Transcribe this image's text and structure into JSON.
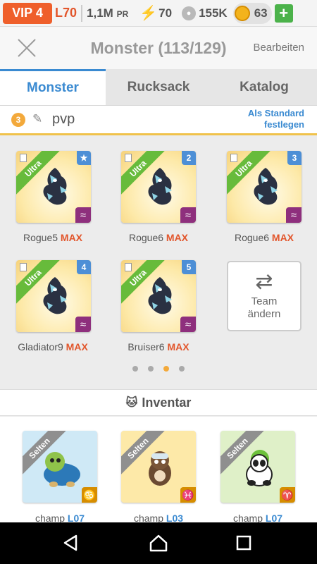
{
  "status": {
    "vip": "VIP 4",
    "level": "L70",
    "pr_value": "1,1M",
    "pr_suffix": "PR",
    "energy": "70",
    "paws": "155K",
    "gems": "63",
    "add_label": "+"
  },
  "header": {
    "title": "Monster (113/129)",
    "edit": "Bearbeiten"
  },
  "tabs": [
    {
      "label": "Monster",
      "active": true
    },
    {
      "label": "Rucksack",
      "active": false
    },
    {
      "label": "Katalog",
      "active": false
    }
  ],
  "team": {
    "number": "3",
    "name": "pvp",
    "default_line1": "Als Standard",
    "default_line2": "festlegen"
  },
  "monsters": [
    {
      "rarity": "Ultra",
      "slot": "★",
      "name": "Rogue5",
      "max": "MAX",
      "element": "≈"
    },
    {
      "rarity": "Ultra",
      "slot": "2",
      "name": "Rogue6",
      "max": "MAX",
      "element": "≈"
    },
    {
      "rarity": "Ultra",
      "slot": "3",
      "name": "Rogue6",
      "max": "MAX",
      "element": "≈"
    },
    {
      "rarity": "Ultra",
      "slot": "4",
      "name": "Gladiator9",
      "max": "MAX",
      "element": "≈"
    },
    {
      "rarity": "Ultra",
      "slot": "5",
      "name": "Bruiser6",
      "max": "MAX",
      "element": "≈"
    }
  ],
  "team_change": {
    "icon": "⇄",
    "line1": "Team",
    "line2": "ändern"
  },
  "page_dots": {
    "count": 4,
    "active": 3
  },
  "inventory": {
    "title": "Inventar",
    "items": [
      {
        "rarity": "Selten",
        "name": "champ",
        "level": "L07",
        "element": "♋",
        "bg": "#cfe9f6"
      },
      {
        "rarity": "Selten",
        "name": "champ",
        "level": "L03",
        "element": "♓",
        "bg": "#fde9a8"
      },
      {
        "rarity": "Selten",
        "name": "champ",
        "level": "L07",
        "element": "♈",
        "bg": "#dff0c8"
      }
    ]
  },
  "colors": {
    "accent": "#3a8ad1",
    "max": "#e2562c",
    "ultra": "#67bb3b",
    "vip": "#ef5f2b"
  }
}
